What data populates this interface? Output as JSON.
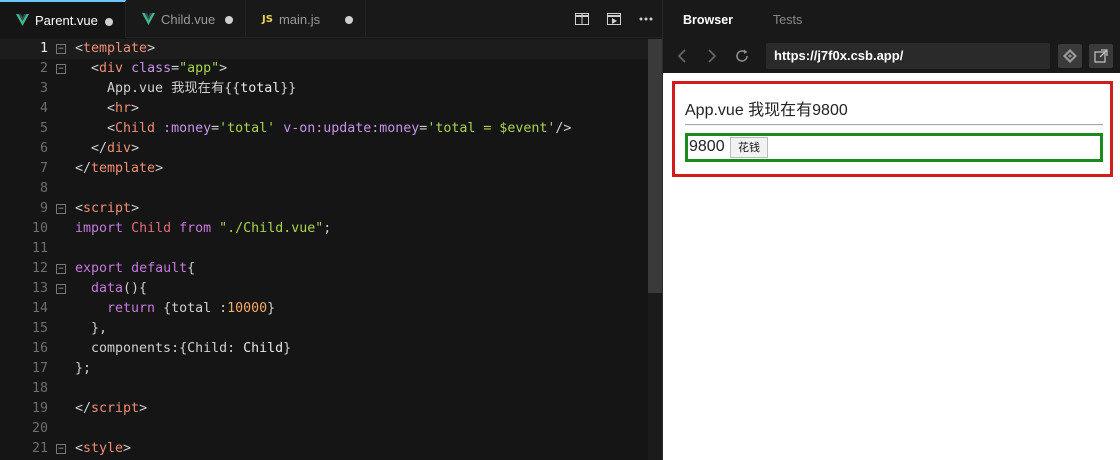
{
  "editor": {
    "tabs": [
      {
        "label": "Parent.vue",
        "icon": "vue-icon",
        "active": true,
        "modified": true
      },
      {
        "label": "Child.vue",
        "icon": "vue-icon",
        "active": false,
        "modified": true
      },
      {
        "label": "main.js",
        "icon": "js-icon",
        "active": false,
        "modified": true
      }
    ],
    "js_badge": "JS",
    "actions": [
      "split-editor-icon",
      "preview-icon",
      "more-icon"
    ],
    "current_line": 1,
    "lines": [
      {
        "n": "1",
        "fold": "−",
        "code": [
          [
            "t-br",
            "<"
          ],
          [
            "t-tag",
            "template"
          ],
          [
            "t-br",
            ">"
          ]
        ]
      },
      {
        "n": "2",
        "fold": "−",
        "code": [
          [
            "t-br",
            "  <"
          ],
          [
            "t-tag",
            "div"
          ],
          [
            "t-br",
            " "
          ],
          [
            "t-attr",
            "class"
          ],
          [
            "t-br",
            "="
          ],
          [
            "t-str",
            "\"app\""
          ],
          [
            "t-br",
            ">"
          ]
        ]
      },
      {
        "n": "3",
        "fold": "",
        "code": [
          [
            "t-br",
            "    App.vue 我现在有{{"
          ],
          [
            "t-id",
            "total"
          ],
          [
            "t-br",
            "}}"
          ]
        ]
      },
      {
        "n": "4",
        "fold": "",
        "code": [
          [
            "t-br",
            "    <"
          ],
          [
            "t-tag",
            "hr"
          ],
          [
            "t-br",
            ">"
          ]
        ]
      },
      {
        "n": "5",
        "fold": "",
        "code": [
          [
            "t-br",
            "    <"
          ],
          [
            "t-tag",
            "Child"
          ],
          [
            "t-br",
            " "
          ],
          [
            "t-attr",
            ":money"
          ],
          [
            "t-br",
            "="
          ],
          [
            "t-str",
            "'total'"
          ],
          [
            "t-br",
            " "
          ],
          [
            "t-attr",
            "v-on:update:money"
          ],
          [
            "t-br",
            "="
          ],
          [
            "t-str",
            "'total = $event'"
          ],
          [
            "t-br",
            "/>"
          ]
        ]
      },
      {
        "n": "6",
        "fold": "",
        "code": [
          [
            "t-br",
            "  </"
          ],
          [
            "t-tag",
            "div"
          ],
          [
            "t-br",
            ">"
          ]
        ]
      },
      {
        "n": "7",
        "fold": "",
        "code": [
          [
            "t-br",
            "</"
          ],
          [
            "t-tag",
            "template"
          ],
          [
            "t-br",
            ">"
          ]
        ]
      },
      {
        "n": "8",
        "fold": "",
        "code": []
      },
      {
        "n": "9",
        "fold": "−",
        "code": [
          [
            "t-br",
            "<"
          ],
          [
            "t-tag",
            "script"
          ],
          [
            "t-br",
            ">"
          ]
        ]
      },
      {
        "n": "10",
        "fold": "",
        "code": [
          [
            "t-kw",
            "import"
          ],
          [
            "t-br",
            " "
          ],
          [
            "t-comp",
            "Child"
          ],
          [
            "t-br",
            " "
          ],
          [
            "t-kw",
            "from"
          ],
          [
            "t-br",
            " "
          ],
          [
            "t-str",
            "\"./Child.vue\""
          ],
          [
            "t-br",
            ";"
          ]
        ]
      },
      {
        "n": "11",
        "fold": "",
        "code": []
      },
      {
        "n": "12",
        "fold": "−",
        "code": [
          [
            "t-kw",
            "export"
          ],
          [
            "t-br",
            " "
          ],
          [
            "t-kw",
            "default"
          ],
          [
            "t-br",
            "{"
          ]
        ]
      },
      {
        "n": "13",
        "fold": "−",
        "code": [
          [
            "t-br",
            "  "
          ],
          [
            "t-fn",
            "data"
          ],
          [
            "t-br",
            "(){"
          ]
        ]
      },
      {
        "n": "14",
        "fold": "",
        "code": [
          [
            "t-br",
            "    "
          ],
          [
            "t-kw",
            "return"
          ],
          [
            "t-br",
            " {total :"
          ],
          [
            "t-num",
            "10000"
          ],
          [
            "t-br",
            "}"
          ]
        ]
      },
      {
        "n": "15",
        "fold": "",
        "code": [
          [
            "t-br",
            "  },"
          ]
        ]
      },
      {
        "n": "16",
        "fold": "",
        "code": [
          [
            "t-br",
            "  components:{Child: "
          ],
          [
            "t-id",
            "Child"
          ],
          [
            "t-br",
            "}"
          ]
        ]
      },
      {
        "n": "17",
        "fold": "",
        "code": [
          [
            "t-br",
            "};"
          ]
        ]
      },
      {
        "n": "18",
        "fold": "",
        "code": []
      },
      {
        "n": "19",
        "fold": "",
        "code": [
          [
            "t-br",
            "</"
          ],
          [
            "t-tag",
            "script"
          ],
          [
            "t-br",
            ">"
          ]
        ]
      },
      {
        "n": "20",
        "fold": "",
        "code": []
      },
      {
        "n": "21",
        "fold": "−",
        "code": [
          [
            "t-br",
            "<"
          ],
          [
            "t-tag",
            "style"
          ],
          [
            "t-br",
            ">"
          ]
        ]
      }
    ]
  },
  "browser": {
    "tabs": [
      {
        "label": "Browser",
        "active": true
      },
      {
        "label": "Tests",
        "active": false
      }
    ],
    "url": "https://j7f0x.csb.app/",
    "page": {
      "title": "App.vue 我现在有9800",
      "money": "9800",
      "spend_button": "花钱"
    },
    "colors": {
      "parent_border": "#d21b1b",
      "child_border": "#1a8a1a"
    }
  }
}
